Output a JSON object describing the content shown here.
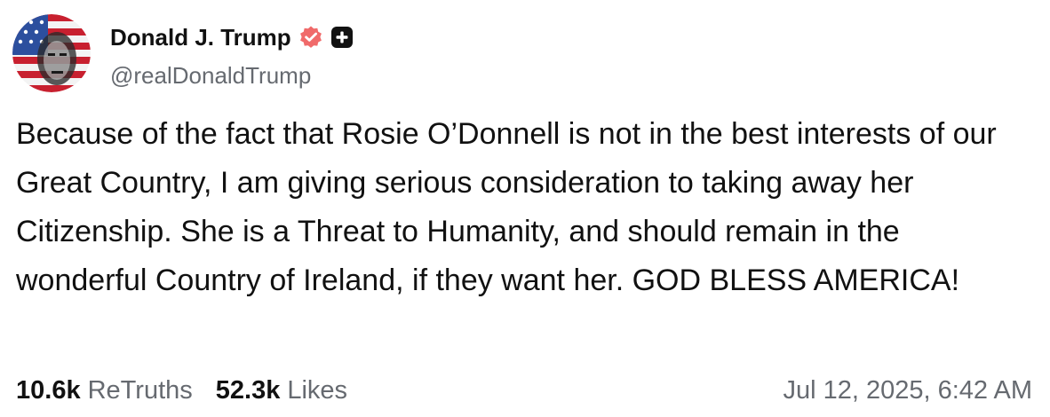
{
  "post": {
    "author": {
      "display_name": "Donald J. Trump",
      "handle": "@realDonaldTrump",
      "verified_badge_icon": "verified-badge-icon",
      "plus_badge_icon": "plus-badge-icon",
      "avatar_icon": "avatar-flag-portrait"
    },
    "text": "Because of the fact that Rosie O’Donnell is not in the best interests of our Great Country, I am giving serious consideration to taking away her Citizenship. She is a Threat to Humanity, and should remain in the wonderful Country of Ireland, if they want her. GOD BLESS AMERICA!",
    "stats": {
      "retruths_count": "10.6k",
      "retruths_label": "ReTruths",
      "likes_count": "52.3k",
      "likes_label": "Likes"
    },
    "timestamp": "Jul 12, 2025, 6:42 AM"
  },
  "colors": {
    "text_primary": "#111111",
    "text_secondary": "#666a70",
    "verified_badge": "#f06a6a",
    "plus_badge": "#111111",
    "background": "#ffffff"
  }
}
